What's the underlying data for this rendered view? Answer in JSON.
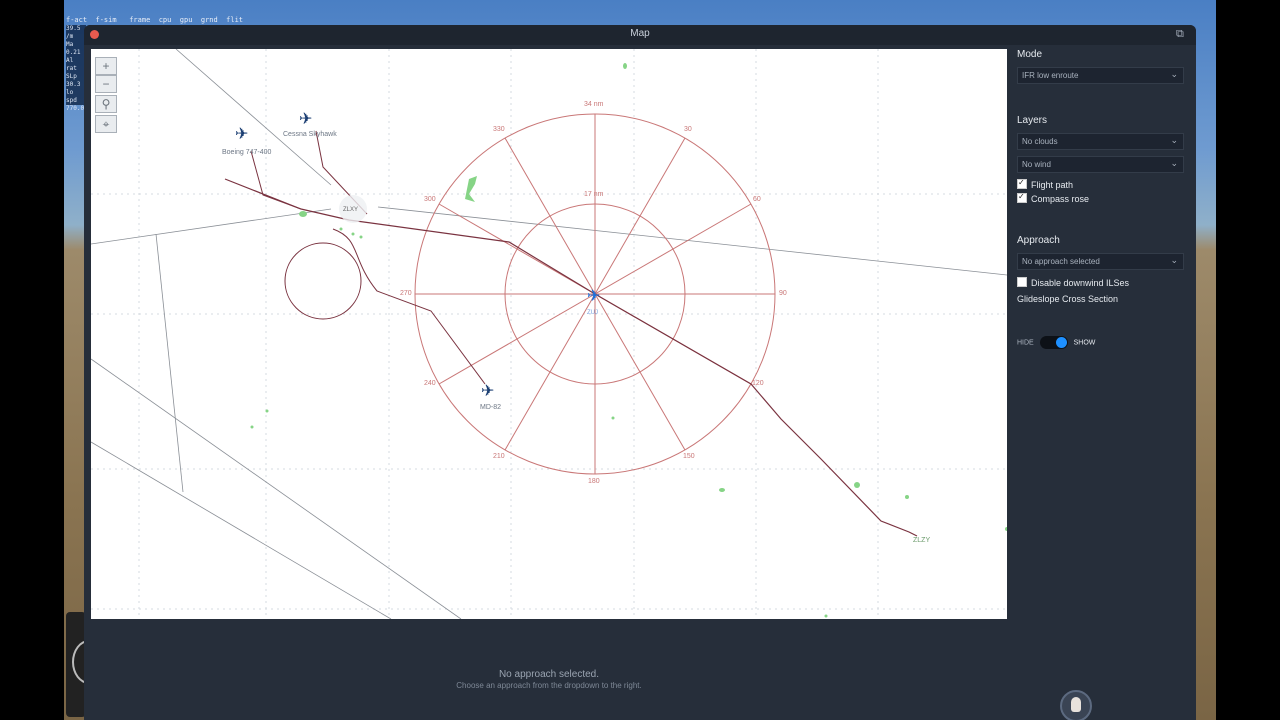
{
  "sim_overlay": {
    "top_readout": "f-act  f-sim   frame  cpu  gpu  grnd  flit",
    "side_readout": [
      "39.5",
      "/m",
      "Ma",
      "0.21",
      "Al",
      "rat",
      "SLp",
      "30.3",
      "lo",
      "spd",
      "770.0"
    ]
  },
  "window": {
    "title": "Map",
    "popout_icon": "popout-icon"
  },
  "map": {
    "controls": [
      "+",
      "−",
      "⚲",
      "⌖"
    ],
    "aircraft": [
      {
        "label": "Boeing 747-400"
      },
      {
        "label": "Cessna Skyhawk"
      },
      {
        "label": "MD-82"
      }
    ],
    "airport_label": "ZLZY",
    "origin_label": "ZLXY",
    "own_ship_label": "ZUJ",
    "rose": {
      "range_outer": "34 nm",
      "range_inner": "17 nm",
      "bearings": [
        "330",
        "30",
        "60",
        "300",
        "90",
        "270",
        "120",
        "240",
        "150",
        "210",
        "180"
      ]
    }
  },
  "sidebar": {
    "mode_title": "Mode",
    "mode_value": "IFR low enroute",
    "layers_title": "Layers",
    "clouds_value": "No clouds",
    "wind_value": "No wind",
    "flight_path_label": "Flight path",
    "flight_path_checked": true,
    "compass_rose_label": "Compass rose",
    "compass_rose_checked": true,
    "approach_title": "Approach",
    "approach_value": "No approach selected",
    "disable_ils_label": "Disable downwind ILSes",
    "disable_ils_checked": false,
    "glideslope_label": "Glideslope Cross Section",
    "toggle_hide": "HIDE",
    "toggle_show": "SHOW"
  },
  "bottom": {
    "message": "No approach selected.",
    "hint": "Choose an approach from the dropdown to the right."
  },
  "colors": {
    "window_bg": "#262e3a",
    "rose": "#c76b6b",
    "flight_path": "#7a3340",
    "own_ship": "#1e6fd9",
    "traffic": "#1c3f73",
    "terrain": "#6fce6f"
  }
}
